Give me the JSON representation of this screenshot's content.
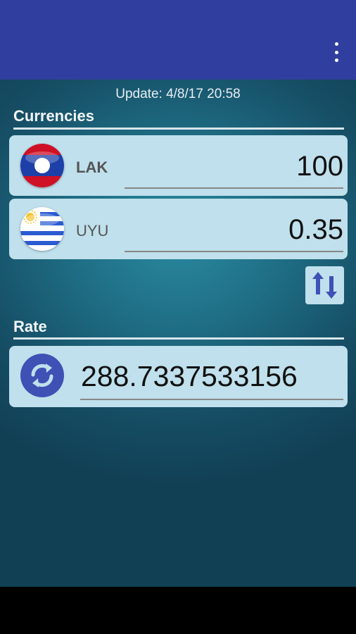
{
  "app": {
    "menu_icon": "overflow-menu-icon"
  },
  "update": {
    "text": "Update: 4/8/17 20:58"
  },
  "sections": {
    "currencies_title": "Currencies",
    "rate_title": "Rate"
  },
  "currencies": [
    {
      "code": "LAK",
      "amount": "100",
      "flag": "laos-flag-icon"
    },
    {
      "code": "UYU",
      "amount": "0.35",
      "flag": "uruguay-flag-icon"
    }
  ],
  "swap": {
    "icon": "swap-vertical-icon"
  },
  "rate": {
    "value": "288.7337533156",
    "icon": "refresh-icon"
  },
  "colors": {
    "appbar": "#303f9f",
    "card": "#bfe0ec",
    "accent": "#3f51b5"
  }
}
